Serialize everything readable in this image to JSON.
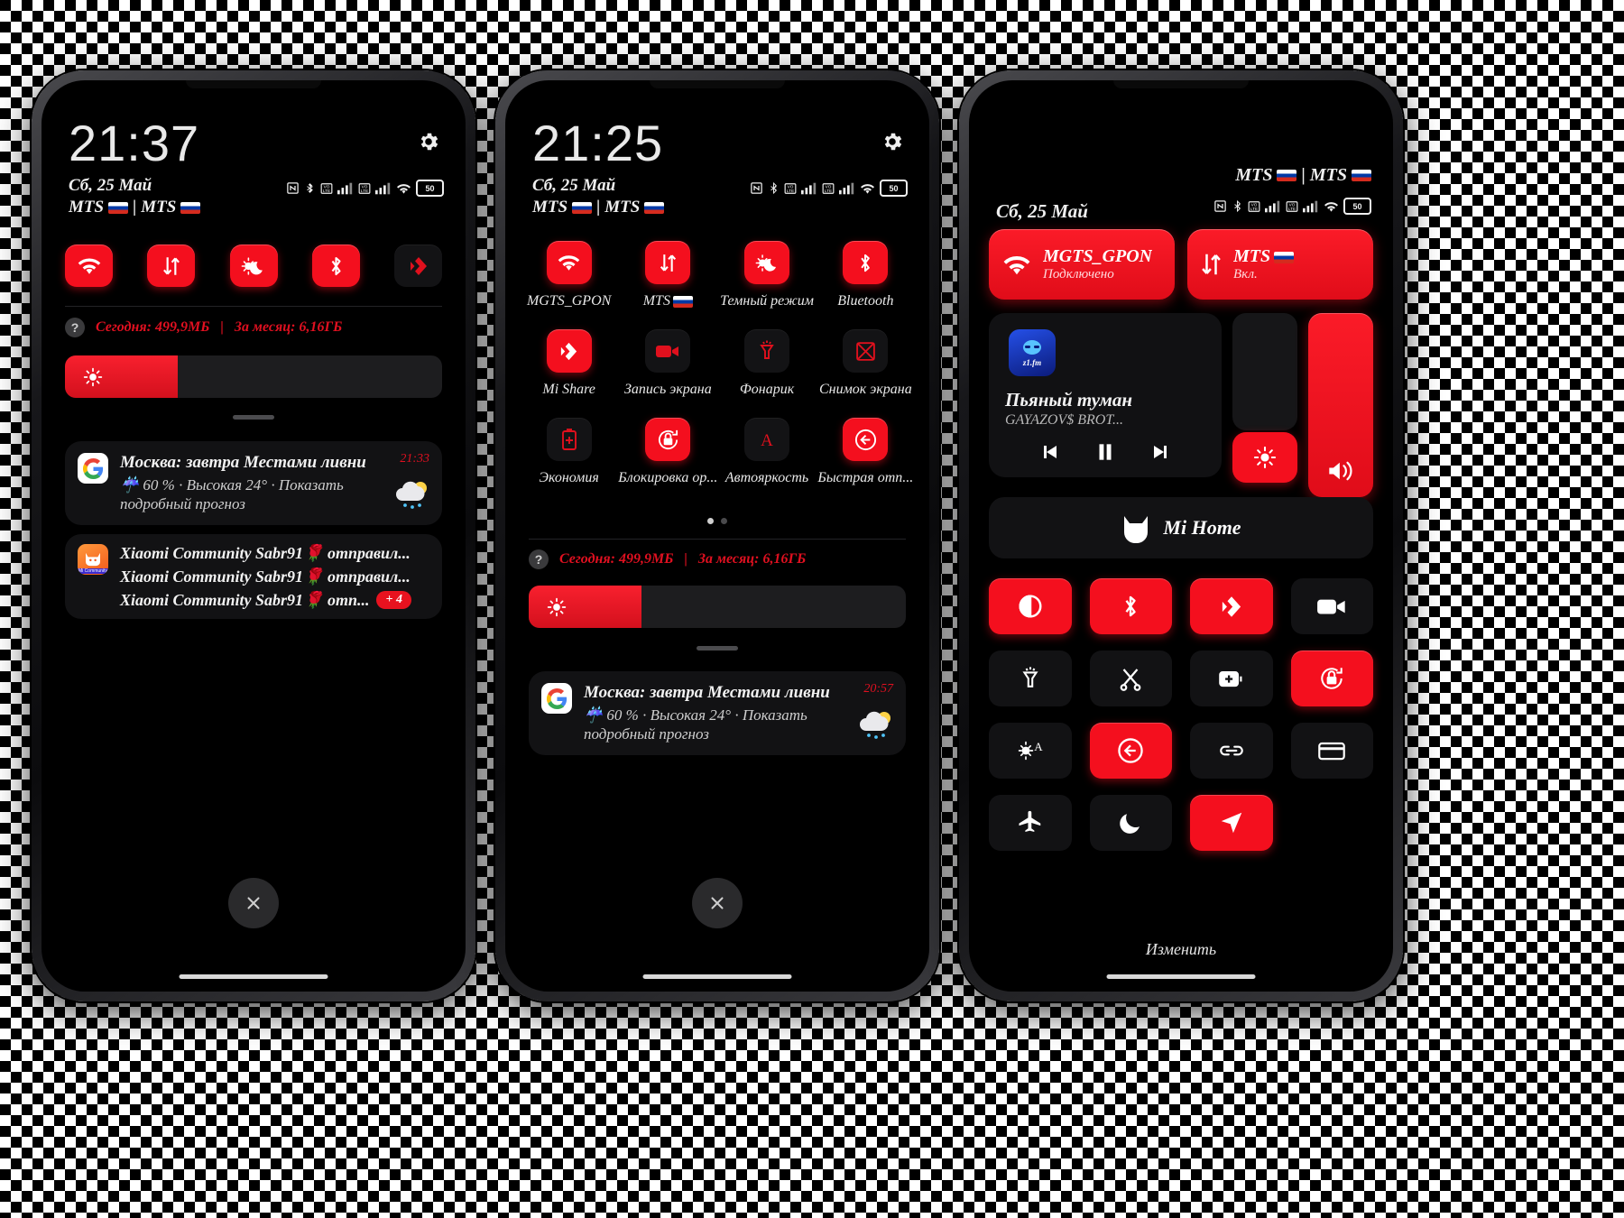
{
  "theme": {
    "accent": "#f40f1e",
    "bg": "#000000",
    "tile_off": "#131315",
    "text": "#e8e8e8"
  },
  "phone1": {
    "clock": "21:37",
    "date": "Сб, 25 Май",
    "carrier1": "MTS",
    "carrier2": "MTS",
    "battery": "50",
    "quick_tiles": [
      {
        "name": "wifi",
        "label": "Wi-Fi",
        "on": true
      },
      {
        "name": "mobile-data",
        "label": "Мобильный интернет",
        "on": true
      },
      {
        "name": "dark-mode",
        "label": "Темный режим",
        "on": true
      },
      {
        "name": "bluetooth",
        "label": "Bluetooth",
        "on": true
      },
      {
        "name": "mi-share",
        "label": "Mi Share",
        "on": false
      }
    ],
    "data_usage": {
      "today_label": "Сегодня: 499,9МБ",
      "month_label": "За месяц: 6,16ГБ",
      "separator": "|"
    },
    "brightness_percent": 30,
    "notifications": [
      {
        "app": "google",
        "title": "Москва: завтра Местами ливни",
        "body": "60 % · Высокая 24° · Показать подробный прогноз",
        "time": "21:33",
        "weather_icon": "rain-sun-cloud"
      },
      {
        "app": "xiaomi-community",
        "lines": [
          "Xiaomi Community Sabr91🌹 отправил...",
          "Xiaomi Community Sabr91🌹 отправил...",
          "Xiaomi Community Sabr91🌹 отп..."
        ],
        "badge": "+ 4"
      }
    ]
  },
  "phone2": {
    "clock": "21:25",
    "date": "Сб, 25 Май",
    "carrier1": "MTS",
    "carrier2": "MTS",
    "battery": "50",
    "tiles": [
      {
        "name": "wifi",
        "label": "MGTS_GPON",
        "on": true,
        "chevron": true
      },
      {
        "name": "mobile-data",
        "label": "MTS",
        "on": true,
        "chevron": true,
        "flag": true
      },
      {
        "name": "dark-mode",
        "label": "Темный режим",
        "on": true,
        "chevron": false
      },
      {
        "name": "bluetooth",
        "label": "Bluetooth",
        "on": true,
        "chevron": true
      },
      {
        "name": "mi-share",
        "label": "Mi Share",
        "on": true,
        "chevron": false
      },
      {
        "name": "screen-record",
        "label": "Запись экрана",
        "on": false,
        "chevron": false
      },
      {
        "name": "flashlight",
        "label": "Фонарик",
        "on": false,
        "chevron": false
      },
      {
        "name": "screenshot",
        "label": "Снимок экрана",
        "on": false,
        "chevron": true
      },
      {
        "name": "battery-saver",
        "label": "Экономия",
        "on": false,
        "chevron": false
      },
      {
        "name": "rotation-lock",
        "label": "Блокировка ор...",
        "on": true,
        "chevron": false
      },
      {
        "name": "auto-brightness",
        "label": "Автояркость",
        "on": false,
        "chevron": false
      },
      {
        "name": "quick-reply",
        "label": "Быстрая отп...",
        "on": true,
        "chevron": false
      }
    ],
    "page_dots": {
      "count": 2,
      "active": 0
    },
    "data_usage": {
      "today_label": "Сегодня: 499,9МБ",
      "month_label": "За месяц: 6,16ГБ",
      "separator": "|"
    },
    "brightness_percent": 30,
    "notification": {
      "app": "google",
      "title": "Москва: завтра Местами ливни",
      "body": "60 % · Высокая 24° · Показать подробный прогноз",
      "time": "20:57"
    }
  },
  "phone3": {
    "date": "Сб, 25 Май",
    "carrier1": "MTS",
    "carrier2": "MTS",
    "battery": "50",
    "big_tiles": [
      {
        "name": "wifi",
        "title": "MGTS_GPON",
        "subtitle": "Подключено"
      },
      {
        "name": "mobile-data",
        "title": "MTS",
        "subtitle": "Вкл.",
        "flag": true
      }
    ],
    "media": {
      "app": "z1.fm",
      "track": "Пьяный туман",
      "artist": "GAYAZOV$ BROT...",
      "state": "playing"
    },
    "mi_home": {
      "label": "Mi Home"
    },
    "controls": [
      {
        "name": "brightness",
        "on": true
      },
      {
        "name": "volume",
        "on": true
      }
    ],
    "grid": [
      {
        "name": "dark-mode",
        "on": true
      },
      {
        "name": "bluetooth",
        "on": true
      },
      {
        "name": "mi-share",
        "on": true
      },
      {
        "name": "screen-record",
        "on": false
      },
      {
        "name": "flashlight",
        "on": false
      },
      {
        "name": "screenshot",
        "on": false
      },
      {
        "name": "battery-saver",
        "on": false
      },
      {
        "name": "rotation-lock",
        "on": true
      },
      {
        "name": "auto-brightness",
        "on": false
      },
      {
        "name": "quick-reply",
        "on": true
      },
      {
        "name": "cast-link",
        "on": false
      },
      {
        "name": "wallet",
        "on": false
      },
      {
        "name": "airplane-mode",
        "on": false
      },
      {
        "name": "do-not-disturb",
        "on": false
      },
      {
        "name": "location",
        "on": true
      }
    ],
    "edit_label": "Изменить"
  }
}
